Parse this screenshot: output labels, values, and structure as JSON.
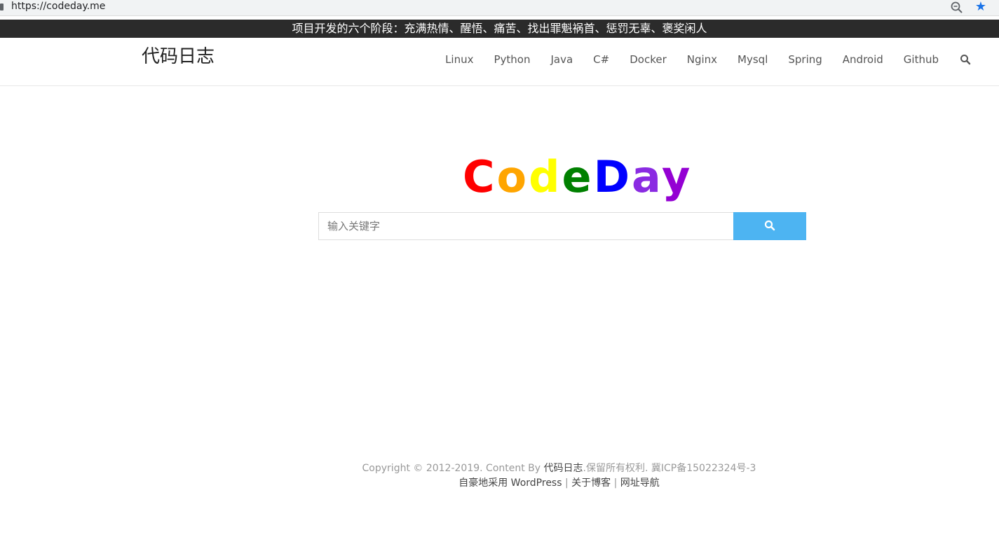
{
  "browser": {
    "url": "https://codeday.me",
    "icons": {
      "lock": "lock-icon",
      "zoom": "zoom-out-icon",
      "bookmark": "star-icon"
    },
    "bookmark_color": "#1a73e8"
  },
  "notice": {
    "text": "项目开发的六个阶段：充满热情、醒悟、痛苦、找出罪魁祸首、惩罚无辜、褒奖闲人",
    "background": "#2b2b2b"
  },
  "header": {
    "site_title": "代码日志",
    "nav_items": [
      "Linux",
      "Python",
      "Java",
      "C#",
      "Docker",
      "Nginx",
      "Mysql",
      "Spring",
      "Android",
      "Github"
    ],
    "search_icon": "search-icon"
  },
  "logo": {
    "letters": [
      {
        "char": "C",
        "color": "#ff0000"
      },
      {
        "char": "o",
        "color": "#ffa500"
      },
      {
        "char": "d",
        "color": "#ffff00"
      },
      {
        "char": "e",
        "color": "#008000"
      },
      {
        "char": "D",
        "color": "#0000ff"
      },
      {
        "char": "a",
        "color": "#8a2be2"
      },
      {
        "char": "y",
        "color": "#9400d3"
      }
    ]
  },
  "search": {
    "placeholder": "输入关键字",
    "value": "",
    "button_color": "#4db4f2",
    "button_icon": "search-icon"
  },
  "footer": {
    "copyright_prefix": "Copyright © 2012-2019. Content By ",
    "copyright_link": "代码日志",
    "copyright_suffix": ".保留所有权利. 冀ICP备15022324号-3",
    "powered_link": "自豪地采用 WordPress",
    "about_link": "关于博客",
    "nav_link": "网址导航",
    "separator": " | "
  }
}
